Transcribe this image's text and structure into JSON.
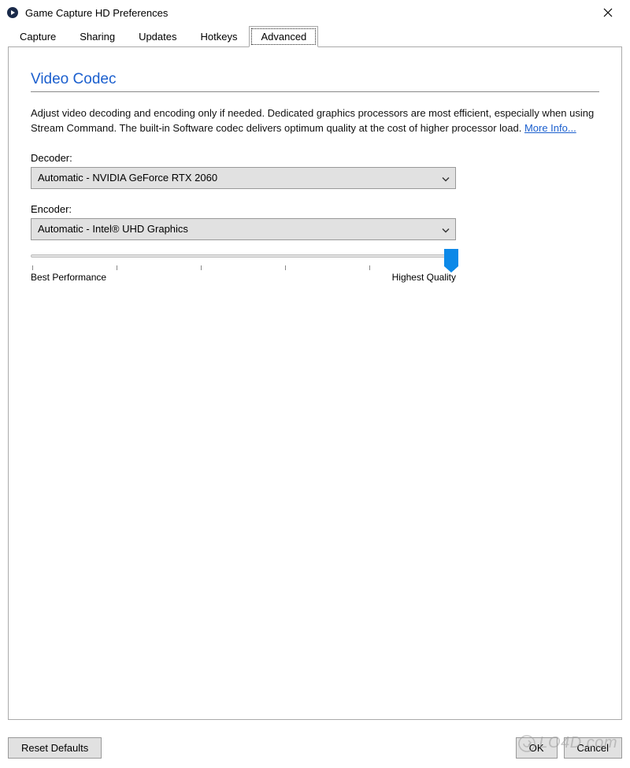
{
  "window": {
    "title": "Game Capture HD Preferences"
  },
  "tabs": [
    {
      "label": "Capture"
    },
    {
      "label": "Sharing"
    },
    {
      "label": "Updates"
    },
    {
      "label": "Hotkeys"
    },
    {
      "label": "Advanced"
    }
  ],
  "section": {
    "title": "Video Codec",
    "description": "Adjust video decoding and encoding only if needed. Dedicated graphics processors are most efficient, especially when using Stream Command. The built-in Software codec delivers optimum quality at the cost of higher processor load. ",
    "more_info": "More Info..."
  },
  "decoder": {
    "label": "Decoder:",
    "selected": "Automatic - NVIDIA GeForce RTX 2060"
  },
  "encoder": {
    "label": "Encoder:",
    "selected": "Automatic - Intel® UHD Graphics"
  },
  "slider": {
    "left_label": "Best Performance",
    "right_label": "Highest Quality"
  },
  "buttons": {
    "reset": "Reset Defaults",
    "ok": "OK",
    "cancel": "Cancel"
  },
  "watermark": "LO4D.com"
}
